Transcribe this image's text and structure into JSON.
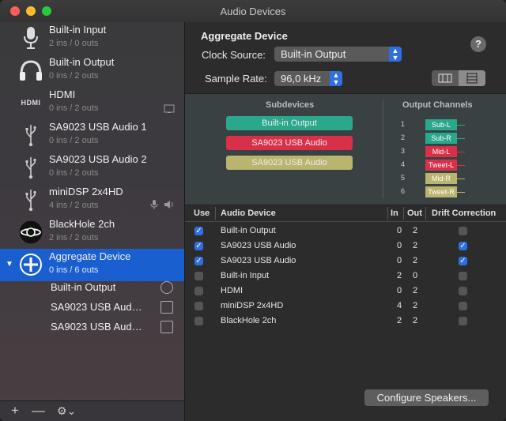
{
  "window": {
    "title": "Audio Devices"
  },
  "devices": [
    {
      "name": "Built-in Input",
      "io": "2 ins / 0 outs",
      "icon": "microphone-icon"
    },
    {
      "name": "Built-in Output",
      "io": "0 ins / 2 outs",
      "icon": "headphones-icon"
    },
    {
      "name": "HDMI",
      "io": "0 ins / 2 outs",
      "icon": "hdmi-icon"
    },
    {
      "name": "SA9023 USB Audio 1",
      "io": "0 ins / 2 outs",
      "icon": "usb-icon"
    },
    {
      "name": "SA9023 USB Audio 2",
      "io": "0 ins / 2 outs",
      "icon": "usb-icon"
    },
    {
      "name": "miniDSP 2x4HD",
      "io": "4 ins / 2 outs",
      "icon": "usb-icon"
    },
    {
      "name": "BlackHole 2ch",
      "io": "2 ins / 2 outs",
      "icon": "blackhole-icon"
    },
    {
      "name": "Aggregate Device",
      "io": "0 ins / 6 outs",
      "icon": "aggregate-icon"
    }
  ],
  "aggregate_children": [
    {
      "name": "Built-in Output"
    },
    {
      "name": "SA9023 USB Aud…"
    },
    {
      "name": "SA9023 USB Aud…"
    }
  ],
  "bottombar": {
    "add": "+",
    "remove": "—",
    "gear": "⚙︎⌄"
  },
  "main": {
    "header": "Aggregate Device",
    "help": "?",
    "clock_label": "Clock Source:",
    "clock_value": "Built-in Output",
    "rate_label": "Sample Rate:",
    "rate_value": "96,0 kHz"
  },
  "panel": {
    "subdevices_title": "Subdevices",
    "channels_title": "Output Channels",
    "subdevices": [
      {
        "name": "Built-in Output",
        "color": "#2aa88c"
      },
      {
        "name": "SA9023 USB Audio",
        "color": "#d9304a"
      },
      {
        "name": "SA9023 USB Audio",
        "color": "#b9b46e"
      }
    ],
    "channels": [
      {
        "num": "1",
        "name": "Sub-L",
        "color": "#2aa88c"
      },
      {
        "num": "2",
        "name": "Sub-R",
        "color": "#2aa88c"
      },
      {
        "num": "3",
        "name": "Mid-L",
        "color": "#d9304a"
      },
      {
        "num": "4",
        "name": "Tweet-L",
        "color": "#d9304a"
      },
      {
        "num": "5",
        "name": "Mid-R",
        "color": "#b9b46e"
      },
      {
        "num": "6",
        "name": "Tweet-R",
        "color": "#b9b46e"
      }
    ]
  },
  "table": {
    "headers": {
      "use": "Use",
      "device": "Audio Device",
      "in": "In",
      "out": "Out",
      "drift": "Drift Correction"
    },
    "rows": [
      {
        "use": true,
        "device": "Built-in Output",
        "in": "0",
        "out": "2",
        "drift": false
      },
      {
        "use": true,
        "device": "SA9023 USB Audio",
        "in": "0",
        "out": "2",
        "drift": true
      },
      {
        "use": true,
        "device": "SA9023 USB Audio",
        "in": "0",
        "out": "2",
        "drift": true
      },
      {
        "use": false,
        "device": "Built-in Input",
        "in": "2",
        "out": "0",
        "drift": false
      },
      {
        "use": false,
        "device": "HDMI",
        "in": "0",
        "out": "2",
        "drift": false
      },
      {
        "use": false,
        "device": "miniDSP 2x4HD",
        "in": "4",
        "out": "2",
        "drift": false
      },
      {
        "use": false,
        "device": "BlackHole 2ch",
        "in": "2",
        "out": "2",
        "drift": false
      }
    ]
  },
  "configure_label": "Configure Speakers..."
}
